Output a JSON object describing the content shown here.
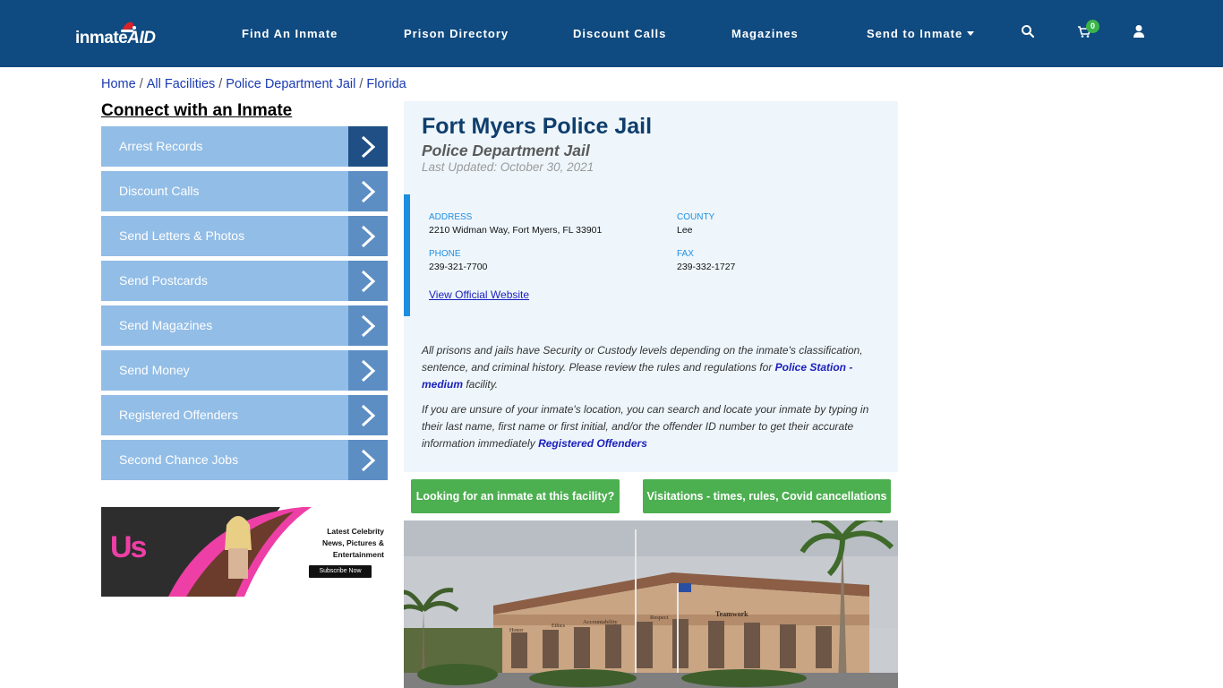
{
  "brand": {
    "logo_main": "inmate",
    "logo_accent": "AID"
  },
  "nav": {
    "items": [
      "Find An Inmate",
      "Prison Directory",
      "Discount Calls",
      "Magazines",
      "Send to Inmate"
    ],
    "cart_count": "0"
  },
  "breadcrumb": [
    "Home",
    "All Facilities",
    "Police Department Jail",
    "Florida"
  ],
  "sidebar": {
    "title": "Connect with an Inmate",
    "items": [
      "Arrest Records",
      "Discount Calls",
      "Send Letters & Photos",
      "Send Postcards",
      "Send Magazines",
      "Send Money",
      "Registered Offenders",
      "Second Chance Jobs"
    ]
  },
  "ad": {
    "logo": "Us",
    "line1": "Latest Celebrity",
    "line2": "News, Pictures &",
    "line3": "Entertainment",
    "cta": "Subscribe Now"
  },
  "facility": {
    "name": "Fort Myers Police Jail",
    "type": "Police Department Jail",
    "updated": "Last Updated: October 30, 2021",
    "address_label": "ADDRESS",
    "address": "2210 Widman Way, Fort Myers, FL 33901",
    "county_label": "COUNTY",
    "county": "Lee",
    "phone_label": "PHONE",
    "phone": "239-321-7700",
    "fax_label": "FAX",
    "fax": "239-332-1727",
    "website_link": "View Official Website"
  },
  "paragraphs": {
    "p1_before": "All prisons and jails have Security or Custody levels depending on the inmate's classification, sentence, and criminal history. Please review the rules and regulations for ",
    "p1_link": "Police Station - medium",
    "p1_after": " facility.",
    "p2_before": "If you are unsure of your inmate's location, you can search and locate your inmate by typing in their last name, first name or first initial, and/or the offender ID number to get their accurate information immediately ",
    "p2_link": "Registered Offenders"
  },
  "actions": {
    "looking": "Looking for an inmate at this facility?",
    "visitations": "Visitations - times, rules, Covid cancellations"
  },
  "photo": {
    "sign_words": [
      "Honor",
      "Ethics",
      "Accountability",
      "Respect",
      "Teamwork"
    ]
  },
  "colors": {
    "nav_bg": "#0f4a80",
    "side_btn": "#92bde6",
    "side_arrow": "#5c8ec4",
    "accent_blue": "#1e8fe0",
    "green": "#4caf50"
  }
}
